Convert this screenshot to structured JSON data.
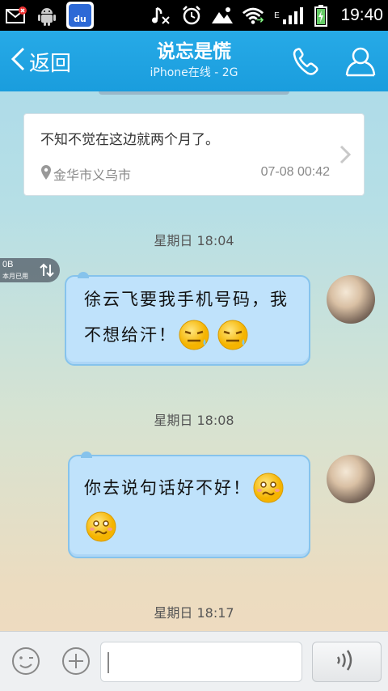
{
  "status_bar": {
    "time": "19:40",
    "network_type": "E",
    "left_icons": [
      "mail-notification-icon",
      "android-icon",
      "baidu-icon"
    ],
    "baidu_label": "du",
    "right_icons": [
      "music-muted-icon",
      "alarm-icon",
      "photo-icon",
      "wifi-icon",
      "signal-icon",
      "battery-charging-icon"
    ]
  },
  "title_bar": {
    "back_label": "返回",
    "contact_name": "说忘是慌",
    "contact_status": "iPhone在线 - 2G",
    "call_icon": "phone-icon",
    "profile_icon": "person-icon"
  },
  "location_card": {
    "text": "不知不觉在这边就两个月了。",
    "place": "金华市义乌市",
    "time": "07-08 00:42"
  },
  "data_usage": {
    "value": "0B",
    "label": "本月已用"
  },
  "messages": [
    {
      "timestamp": "星期日 18:04",
      "line1": "徐云飞要我手机号码，我",
      "line2": "不想给汗！",
      "emojis": [
        "sweat-emoji",
        "sweat-emoji"
      ]
    },
    {
      "timestamp": "星期日 18:08",
      "line1": "你去说句话好不好！",
      "emojis": [
        "worried-emoji",
        "worried-emoji"
      ]
    },
    {
      "timestamp": "星期日 18:17"
    }
  ],
  "input_bar": {
    "emoji_button": "smiley-icon",
    "plus_button": "plus-icon",
    "input_value": "",
    "voice_button": "voice-icon"
  },
  "colors": {
    "title_bar": "#1ea2e0",
    "bubble_fill": "#bfe2fb",
    "bubble_border": "#86c3ec"
  }
}
